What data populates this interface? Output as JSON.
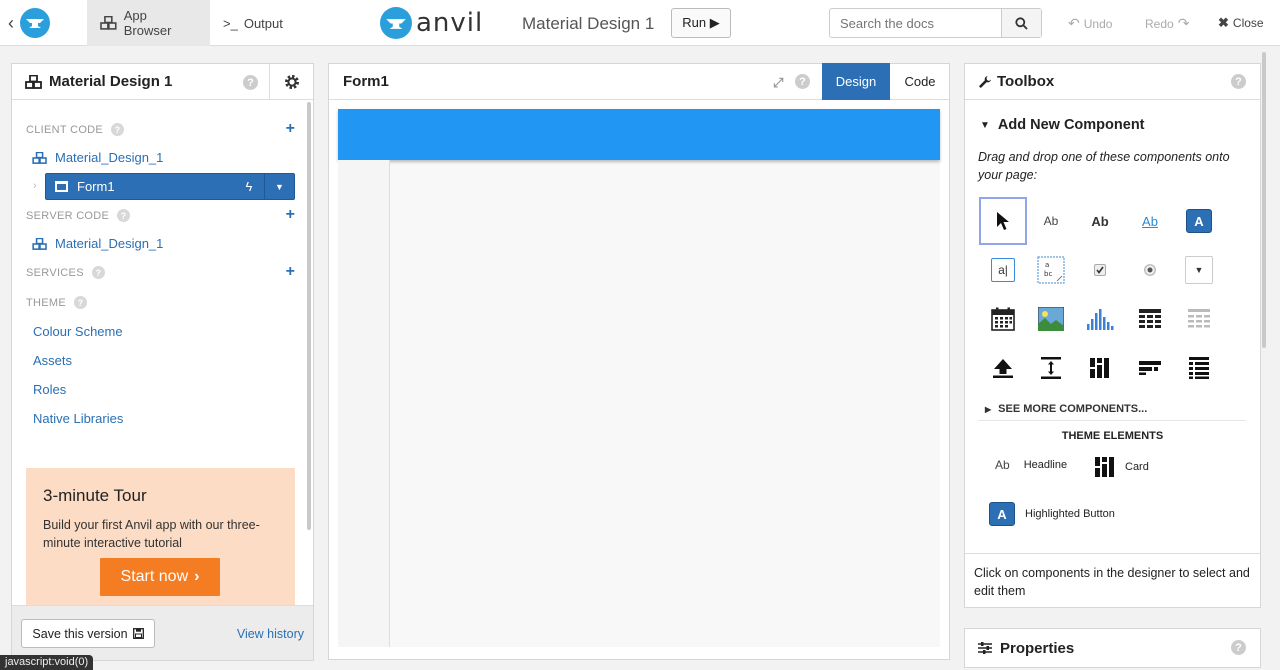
{
  "topbar": {
    "app_browser_tab": "App Browser",
    "output_tab": "Output",
    "output_prefix": ">_",
    "brand": "anvil",
    "app_title": "Material Design 1",
    "run_label": "Run ▶",
    "search_placeholder": "Search the docs",
    "undo_label": "Undo",
    "redo_label": "Redo",
    "close_label": "Close"
  },
  "left": {
    "title": "Material Design 1",
    "client_code_title": "CLIENT CODE",
    "client_module": "Material_Design_1",
    "form_item": "Form1",
    "server_code_title": "SERVER CODE",
    "server_module": "Material_Design_1",
    "services_title": "SERVICES",
    "theme_title": "THEME",
    "theme_items": [
      "Colour Scheme",
      "Assets",
      "Roles",
      "Native Libraries"
    ],
    "tour": {
      "title": "3-minute Tour",
      "text": "Build your first Anvil app with our three-minute interactive tutorial",
      "button": "Start now"
    },
    "save_version": "Save this version",
    "view_history": "View history"
  },
  "center": {
    "title": "Form1",
    "design_tab": "Design",
    "code_tab": "Code"
  },
  "toolbox": {
    "title": "Toolbox",
    "add_new": "Add New Component",
    "hint": "Drag and drop one of these components onto your page:",
    "label_ab": "Ab",
    "button_a": "A",
    "see_more": "SEE MORE COMPONENTS...",
    "theme_elements_title": "THEME ELEMENTS",
    "headline": "Headline",
    "card": "Card",
    "highlighted_button": "Highlighted Button",
    "footer_hint": "Click on components in the designer to select and edit them"
  },
  "properties": {
    "title": "Properties"
  },
  "status_tip": "javascript:void(0)",
  "colors": {
    "accent_blue": "#2d6fb4",
    "form_header": "#2196f3",
    "tour_bg": "#fcdcc4",
    "start_button": "#f47c22"
  }
}
